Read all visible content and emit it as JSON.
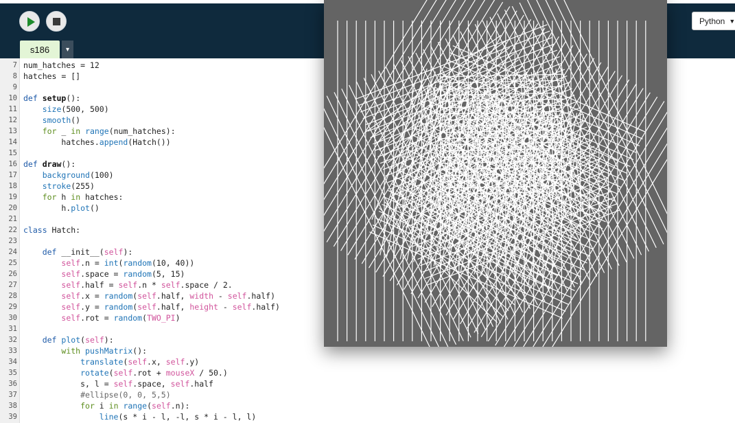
{
  "toolbar": {
    "run_button": "play-icon",
    "stop_button": "stop-icon",
    "mode": "Python",
    "mode_caret": "▼"
  },
  "tabs": [
    {
      "label": "s186",
      "active": true
    }
  ],
  "tab_dropdown": "▾",
  "editor": {
    "lines": [
      {
        "n": "7",
        "text": "num_hatches = 12"
      },
      {
        "n": "8",
        "text": "hatches = []"
      },
      {
        "n": "9",
        "text": ""
      },
      {
        "n": "10",
        "text": "def setup():"
      },
      {
        "n": "11",
        "text": "    size(500, 500)"
      },
      {
        "n": "12",
        "text": "    smooth()"
      },
      {
        "n": "13",
        "text": "    for _ in range(num_hatches):"
      },
      {
        "n": "14",
        "text": "        hatches.append(Hatch())"
      },
      {
        "n": "15",
        "text": ""
      },
      {
        "n": "16",
        "text": "def draw():"
      },
      {
        "n": "17",
        "text": "    background(100)"
      },
      {
        "n": "18",
        "text": "    stroke(255)"
      },
      {
        "n": "19",
        "text": "    for h in hatches:"
      },
      {
        "n": "20",
        "text": "        h.plot()"
      },
      {
        "n": "21",
        "text": ""
      },
      {
        "n": "22",
        "text": "class Hatch:"
      },
      {
        "n": "23",
        "text": ""
      },
      {
        "n": "24",
        "text": "    def __init__(self):"
      },
      {
        "n": "25",
        "text": "        self.n = int(random(10, 40))"
      },
      {
        "n": "26",
        "text": "        self.space = random(5, 15)"
      },
      {
        "n": "27",
        "text": "        self.half = self.n * self.space / 2."
      },
      {
        "n": "28",
        "text": "        self.x = random(self.half, width - self.half)"
      },
      {
        "n": "29",
        "text": "        self.y = random(self.half, height - self.half)"
      },
      {
        "n": "30",
        "text": "        self.rot = random(TWO_PI)"
      },
      {
        "n": "31",
        "text": ""
      },
      {
        "n": "32",
        "text": "    def plot(self):"
      },
      {
        "n": "33",
        "text": "        with pushMatrix():"
      },
      {
        "n": "34",
        "text": "            translate(self.x, self.y)"
      },
      {
        "n": "35",
        "text": "            rotate(self.rot + mouseX / 50.)"
      },
      {
        "n": "36",
        "text": "            s, l = self.space, self.half"
      },
      {
        "n": "37",
        "text": "            #ellipse(0, 0, 5,5)"
      },
      {
        "n": "38",
        "text": "            for i in range(self.n):"
      },
      {
        "n": "39",
        "text": "                line(s * i - l, -l, s * i - l, l)"
      }
    ]
  },
  "sketch": {
    "background": "#646464",
    "stroke": "#ffffff"
  }
}
